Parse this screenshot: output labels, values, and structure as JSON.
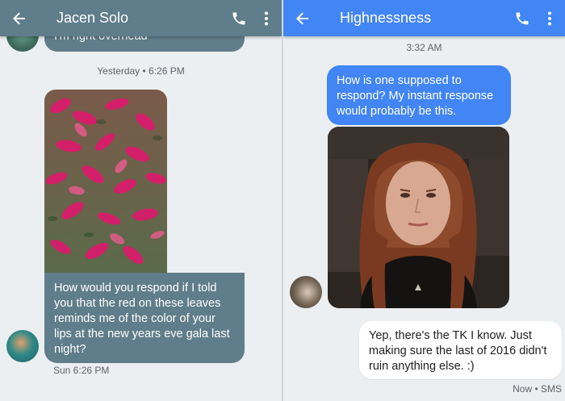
{
  "left": {
    "contact_name": "Jacen Solo",
    "partial_message": "I'm right overhead",
    "date_divider": "Yesterday • 6:26 PM",
    "message": "How would you respond if I told you that the red on these leaves reminds me of the color of your lips at the new years eve gala last night?",
    "message_time": "Sun 6:26 PM",
    "icons": {
      "back": "arrow-back-icon",
      "call": "phone-icon",
      "more": "more-vert-icon"
    },
    "colors": {
      "appbar": "#607d8b",
      "bubble": "#607d8b"
    }
  },
  "right": {
    "contact_name": "Highnessness",
    "time_divider": "3:32 AM",
    "outgoing_message": "How is one supposed to respond? My instant response would probably be this.",
    "reply_message": "Yep, there's the TK I know. Just making sure the last of 2016 didn't ruin anything else. :)",
    "reply_status": "Now • SMS",
    "icons": {
      "back": "arrow-back-icon",
      "call": "phone-icon",
      "more": "more-vert-icon"
    },
    "colors": {
      "appbar": "#4285f4",
      "bubble": "#4285f4"
    }
  }
}
